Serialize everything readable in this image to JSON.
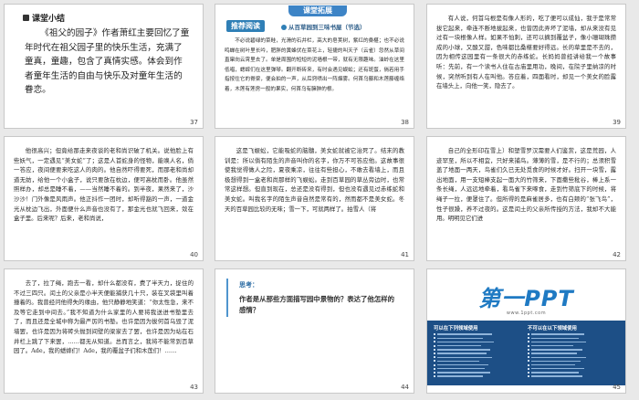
{
  "slides": [
    {
      "number": "37",
      "heading": "课堂小结",
      "text": "《祖父的园子》作者萧红主要回忆了童年时代在祖父园子里的快乐生活，充满了童真，童趣，包含了真情实感。体会到作者童年生活的自由与快乐及对童年生活的眷恋。"
    },
    {
      "number": "38",
      "banner": "课堂拓展",
      "tag": "推荐阅读",
      "source": "从百草园到三味书屋（节选）",
      "text": "不必说碧绿的菜畦，光滑的石井栏，高大的皂荚树，紫红的桑椹；也不必说鸣蝉在树叶里长吟，肥胖的黄蜂伏在菜花上，轻捷的叫天子（云雀）忽然从草间直窜向云霄里去了。单是周围的短短的泥墙根一带，就有无限趣味。油蛉在这里低唱，蟋蟀们在这里弹琴。翻开断砖来，有时会遇见蜈蚣；还有斑蝥，倘若用手指按住它的脊梁，便会拍的一声，从后窍喷出一阵烟雾。何首乌藤和木莲藤缠络着，木莲有莲房一般的果实，何首乌有臃肿的根。"
    },
    {
      "number": "39",
      "text": "有人说，何首乌根是有像人形的，吃了便可以成仙，我于是常常拔它起来，牵连不断地拔起来，也曾因此弄坏了泥墙，却从来没有见过有一块根像人样。如果不怕刺，还可以摘到覆盆子，像小珊瑚珠攒成的小球，又酸又甜，色味都比桑椹要好得远。长的草里是不去的，因为相传这园里有一条很大的赤练蛇。长妈妈曾经讲给我一个故事听：先前，有一个读书人住在古庙里用功，晚间，在院子里纳凉的时候，突然听到有人在叫他。答应着，四面看时，却见一个美女的脸露在墙头上，向他一笑，隐去了。"
    },
    {
      "number": "40",
      "text": "他很高兴；但竟给那走来夜谈的老和尚识破了机关。说他脸上有些妖气，一定遇见“美女蛇”了；这是人首蛇身的怪物，能唤人名，倘一答应，夜间便要来吃这人的肉的。他自然吓得要死，而那老和尚却道无妨，给他一个小盒子，说只要放在枕边，便可高枕而卧。他虽然照样办，却总是睡不着，——当然睡不着的。到半夜，果然来了，沙沙沙！门外像是风雨声。他正抖作一团时，却听得豁的一声，一道金光从枕边飞出，外面便什么声音也没有了，那金光也就飞回来，敛在盒子里。后来呢？后来，老和尚说，"
    },
    {
      "number": "41",
      "text": "这是飞蜈蚣，它能吸蛇的脑髓，美女蛇就被它治死了。结末的教训是：所以倘有陌生的声音叫你的名字，你万不可答应他。这故事很使我觉得做人之险，夏夜乘凉，往往有些担心，不敢去看墙上，而且极想得到一盒老和尚那样的飞蜈蚣。走到百草园的草丛旁边时，也常常这样想。但直到现在，总还是没有得到，但也没有遇见过赤练蛇和美女蛇。叫我名字的陌生声音自然是常有的，然而都不是美女蛇。冬天的百草园比较的无味；雪一下，可就两样了。拍雪人（将"
    },
    {
      "number": "42",
      "text": "自己的全形印在雪上）和塑雪罗汉需要人们鉴赏，这是荒园，人迹罕至，所以不相宜，只好来捕鸟。薄薄的雪，是不行的；总须积雪盖了地面一两天，鸟雀们久已无处觅食的时候才好。扫开一块雪，露出地面，用一支短棒支起一面大的竹筛来，下面撒些秕谷，棒上系一条长绳，人远远地牵着，看鸟雀下来啄食，走到竹筛底下的时候，将绳子一拉，便罩住了。但所得的是麻雀居多，也有白颊的“张飞鸟”，性子很躁，养不过夜的。这是闰土的父亲所传授的方法，我却不大能用。明明见它们进"
    },
    {
      "number": "43",
      "text": "去了，拉了绳，跑去一看，却什么都没有，费了半天力，捉住的不过三四只。闰土的父亲是小半天便能捕获几十只，装在叉袋里叫着撞着的。我曾经问他得失的缘由，他只静静地笑道：“你太性急，来不及等它走到中间去。”我不知道为什么家里的人要将我送进书塾里去了，而且还是全城中称为最严厉的书塾。也许是因为拔何首乌毁了泥墙罢，也许是因为将砖头抛到间壁的梁家去了罢，也许是因为站在石井栏上跳了下来罢，……都无从知道。总而言之，我将不能常到百草园了。Ade，我的蟋蟀们！Ade，我的覆盆子们和木莲们！……"
    },
    {
      "number": "44",
      "label": "思考：",
      "question": "作者是从那些方面描写园中景物的？表达了他怎样的感情？"
    },
    {
      "number": "45",
      "brand": "第一PPT",
      "brand_sub": "www.1ppt.com",
      "left_title": "可以在下列领域使用",
      "right_title": "不可以在以下领域使用"
    }
  ]
}
